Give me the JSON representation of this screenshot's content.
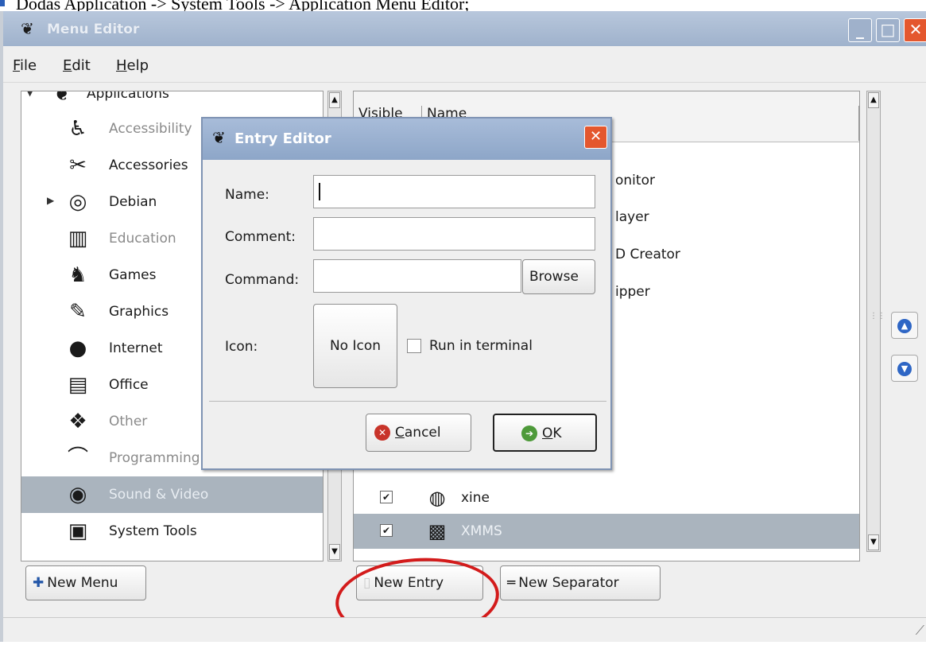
{
  "caption": {
    "text": "Dodas Application -> System Tools -> Application Menu Editor;"
  },
  "window": {
    "title": "Menu Editor",
    "controls": {
      "minimize": "_",
      "maximize": "□",
      "close": "✕"
    }
  },
  "menubar": {
    "file": {
      "mnemonic": "F",
      "rest": "ile"
    },
    "edit": {
      "mnemonic": "E",
      "rest": "dit"
    },
    "help": {
      "mnemonic": "H",
      "rest": "elp"
    }
  },
  "tree": {
    "root_label": "Applications",
    "items": [
      {
        "label": "Accessibility",
        "icon": "accessibility-icon",
        "glyph": "♿",
        "dim": true
      },
      {
        "label": "Accessories",
        "icon": "accessories-icon",
        "glyph": "✂",
        "dim": false
      },
      {
        "label": "Debian",
        "icon": "debian-icon",
        "glyph": "◎",
        "dim": false
      },
      {
        "label": "Education",
        "icon": "education-icon",
        "glyph": "▥",
        "dim": true
      },
      {
        "label": "Games",
        "icon": "games-icon",
        "glyph": "♞",
        "dim": false
      },
      {
        "label": "Graphics",
        "icon": "graphics-icon",
        "glyph": "✎",
        "dim": false
      },
      {
        "label": "Internet",
        "icon": "internet-icon",
        "glyph": "●",
        "dim": false
      },
      {
        "label": "Office",
        "icon": "office-icon",
        "glyph": "▤",
        "dim": false
      },
      {
        "label": "Other",
        "icon": "other-icon",
        "glyph": "❖",
        "dim": true
      },
      {
        "label": "Programming",
        "icon": "programming-icon",
        "glyph": "⌒",
        "dim": true
      },
      {
        "label": "Sound & Video",
        "icon": "sound-video-icon",
        "glyph": "◉",
        "dim": false,
        "selected": true
      },
      {
        "label": "System Tools",
        "icon": "system-tools-icon",
        "glyph": "▣",
        "dim": false
      }
    ]
  },
  "list": {
    "columns": {
      "visible": "Visible",
      "name": "Name"
    },
    "partial_labels": [
      "onitor",
      "layer",
      "D Creator",
      "ipper"
    ],
    "rows": [
      {
        "label": "xine",
        "icon": "xine-icon",
        "glyph": "◍",
        "checked": "✔"
      },
      {
        "label": "XMMS",
        "icon": "xmms-icon",
        "glyph": "▩",
        "checked": "✔",
        "selected": true
      }
    ]
  },
  "buttons": {
    "new_menu": "New Menu",
    "new_entry": "New Entry",
    "new_separator": "New Separator"
  },
  "dialog": {
    "title": "Entry Editor",
    "close": "✕",
    "name_label": "Name:",
    "name_value": "",
    "comment_label": "Comment:",
    "comment_value": "",
    "command_label": "Command:",
    "command_value": "",
    "browse": "Browse",
    "icon_label": "Icon:",
    "no_icon": "No Icon",
    "run_in_terminal": "Run in terminal",
    "cancel": {
      "mnemonic": "C",
      "rest": "ancel"
    },
    "ok": {
      "mnemonic": "O",
      "rest": "K"
    }
  },
  "colors": {
    "selection": "#aab4be",
    "titlebar": "#9fb2cc",
    "annotation": "#d31b1b"
  }
}
